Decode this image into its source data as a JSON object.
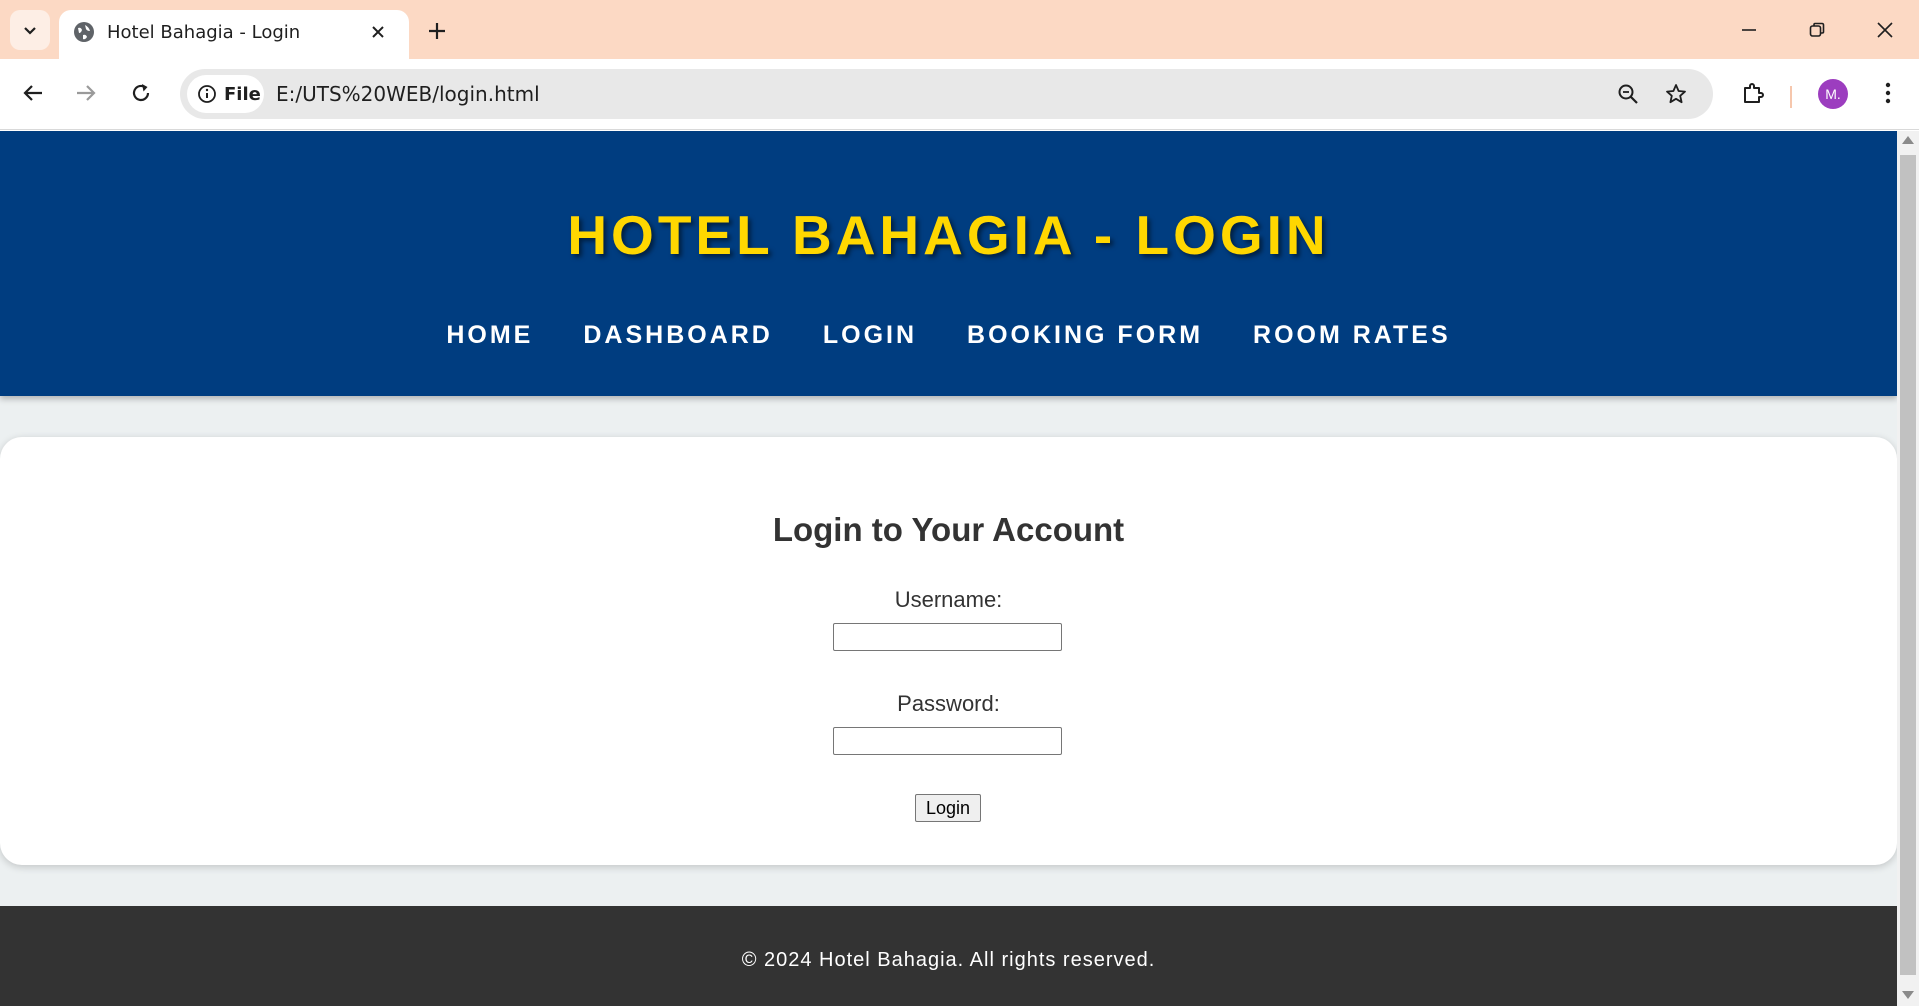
{
  "browser": {
    "tab_title": "Hotel Bahagia - Login",
    "site_info_label": "File",
    "url": "E:/UTS%20WEB/login.html",
    "profile_initial": "M."
  },
  "site": {
    "title": "HOTEL BAHAGIA - LOGIN",
    "nav": [
      "HOME",
      "DASHBOARD",
      "LOGIN",
      "BOOKING FORM",
      "ROOM RATES"
    ]
  },
  "login_form": {
    "heading": "Login to Your Account",
    "username_label": "Username:",
    "username_value": "",
    "password_label": "Password:",
    "password_value": "",
    "submit_label": "Login"
  },
  "footer": {
    "text": "© 2024 Hotel Bahagia. All rights reserved."
  },
  "colors": {
    "header_bg": "#003d80",
    "title": "#ffd700",
    "page_bg": "#ecf0f1",
    "footer_bg": "#333333",
    "tabbar_bg": "#fcd9c4"
  },
  "icons": [
    "tab-list-icon",
    "globe-icon",
    "close-icon",
    "plus-icon",
    "minimize-icon",
    "restore-icon",
    "window-close-icon",
    "back-icon",
    "forward-icon",
    "reload-icon",
    "info-icon",
    "zoom-icon",
    "star-icon",
    "extensions-icon",
    "more-icon"
  ]
}
